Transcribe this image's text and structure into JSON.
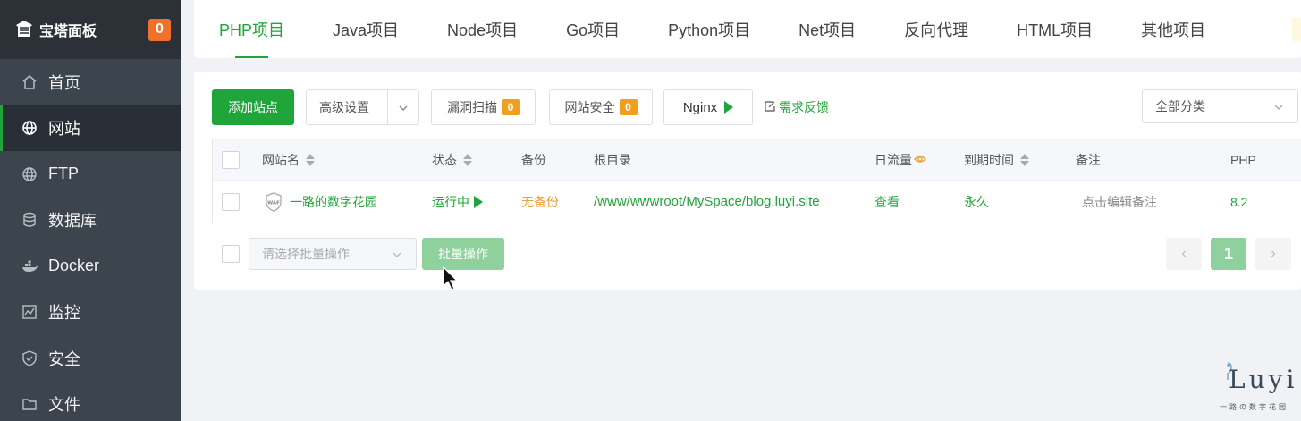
{
  "sidebar": {
    "brand_title": "宝塔面板",
    "brand_badge": "0",
    "items": [
      {
        "label": "首页",
        "icon": "home-icon"
      },
      {
        "label": "网站",
        "icon": "globe-icon"
      },
      {
        "label": "FTP",
        "icon": "ftp-icon"
      },
      {
        "label": "数据库",
        "icon": "database-icon"
      },
      {
        "label": "Docker",
        "icon": "docker-icon"
      },
      {
        "label": "监控",
        "icon": "monitor-icon"
      },
      {
        "label": "安全",
        "icon": "shield-icon"
      },
      {
        "label": "文件",
        "icon": "folder-icon"
      }
    ],
    "active_index": 1
  },
  "tabs": {
    "items": [
      "PHP项目",
      "Java项目",
      "Node项目",
      "Go项目",
      "Python项目",
      "Net项目",
      "反向代理",
      "HTML项目",
      "其他项目"
    ],
    "active_index": 0
  },
  "toolbar": {
    "add_site": "添加站点",
    "advanced": "高级设置",
    "vuln_scan": "漏洞扫描",
    "vuln_scan_badge": "0",
    "site_security": "网站安全",
    "site_security_badge": "0",
    "nginx": "Nginx",
    "feedback": "需求反馈",
    "category_select": "全部分类"
  },
  "table": {
    "headers": {
      "name": "网站名",
      "status": "状态",
      "backup": "备份",
      "root": "根目录",
      "traffic": "日流量",
      "expire": "到期时间",
      "remark": "备注",
      "php": "PHP"
    },
    "rows": [
      {
        "name": "一路的数字花园",
        "waf_badge": "WAF",
        "status": "运行中",
        "backup": "无备份",
        "root": "/www/wwwroot/MySpace/blog.luyi.site",
        "traffic": "查看",
        "expire": "永久",
        "remark": "点击编辑备注",
        "php": "8.2"
      }
    ]
  },
  "footer": {
    "batch_placeholder": "请选择批量操作",
    "batch_button": "批量操作",
    "prev": "‹",
    "current_page": "1",
    "next": "›"
  },
  "watermark": {
    "text": "Luyi",
    "sub": "一路の数字花园"
  },
  "colors": {
    "accent": "#20a53a",
    "sidebar_bg": "#3c444d",
    "badge_orange": "#f0712b",
    "warning": "#e6a23c"
  }
}
